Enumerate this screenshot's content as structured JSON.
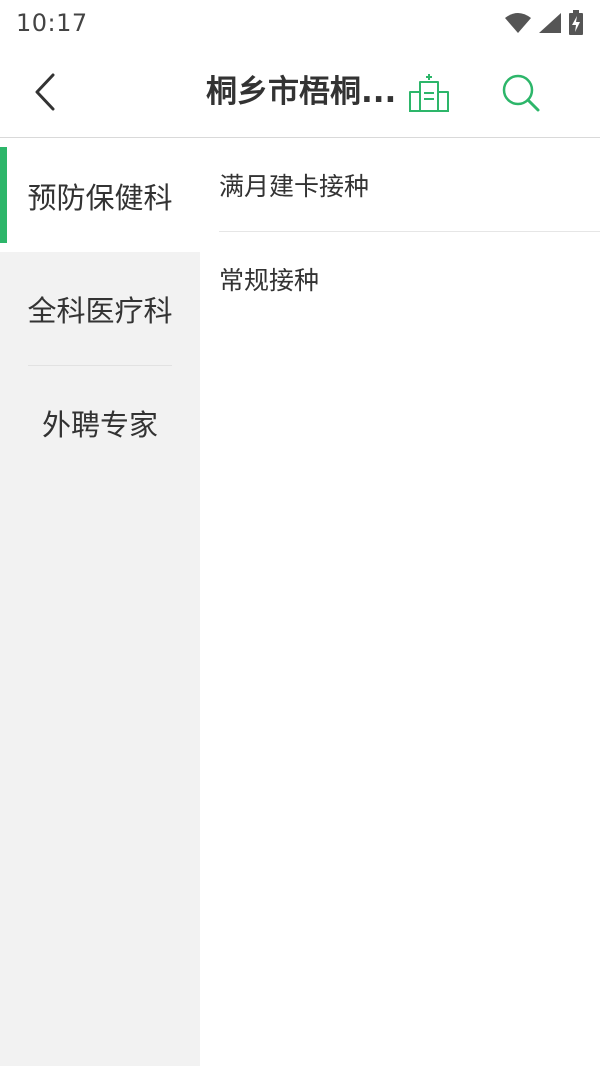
{
  "status_bar": {
    "time": "10:17"
  },
  "header": {
    "title": "桐乡市梧桐...",
    "back_icon": "chevron-left-icon",
    "hospital_icon": "hospital-icon",
    "search_icon": "search-icon",
    "accent_color": "#2db66a"
  },
  "sidebar": {
    "items": [
      {
        "label": "预防保健科",
        "active": true
      },
      {
        "label": "全科医疗科",
        "active": false
      },
      {
        "label": "外聘专家",
        "active": false
      }
    ]
  },
  "content": {
    "items": [
      {
        "label": "满月建卡接种"
      },
      {
        "label": "常规接种"
      }
    ]
  }
}
